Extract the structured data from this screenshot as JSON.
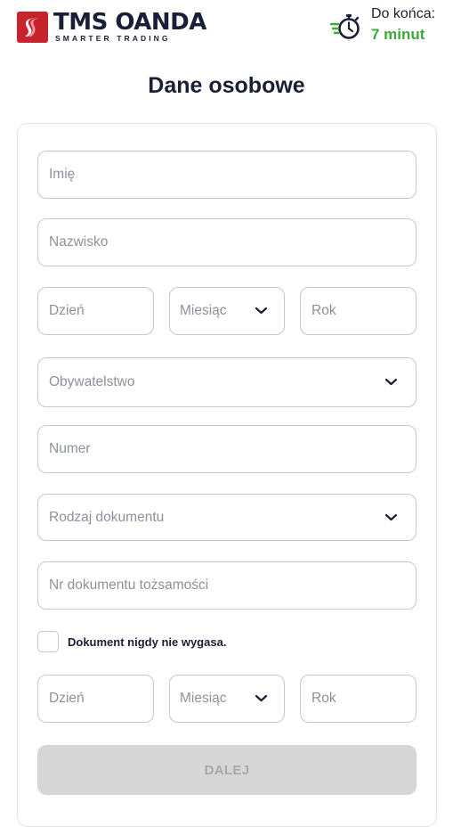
{
  "header": {
    "logo_main": "TMS OANDA",
    "logo_sub": "SMARTER TRADING",
    "timer_label": "Do końca:",
    "timer_value": "7 minut"
  },
  "page": {
    "title": "Dane osobowe"
  },
  "form": {
    "first_name_placeholder": "Imię",
    "last_name_placeholder": "Nazwisko",
    "birth_day_placeholder": "Dzień",
    "birth_month_placeholder": "Miesiąc",
    "birth_year_placeholder": "Rok",
    "citizenship_placeholder": "Obywatelstwo",
    "number_placeholder": "Numer",
    "document_type_placeholder": "Rodzaj dokumentu",
    "document_number_placeholder": "Nr dokumentu tożsamości",
    "no_expiry_label": "Dokument nigdy nie wygasa.",
    "expiry_day_placeholder": "Dzień",
    "expiry_month_placeholder": "Miesiąc",
    "expiry_year_placeholder": "Rok",
    "submit_label": "DALEJ"
  },
  "colors": {
    "brand_red": "#c8232c",
    "timer_green": "#3ea83a",
    "text_dark": "#1a1f36",
    "placeholder": "#8e919c",
    "border": "#c6c8d0",
    "button_disabled": "#d6d6d6"
  },
  "icons": {
    "logo": "tms-oanda-logo-icon",
    "timer": "stopwatch-icon",
    "dropdown": "chevron-down-icon"
  }
}
